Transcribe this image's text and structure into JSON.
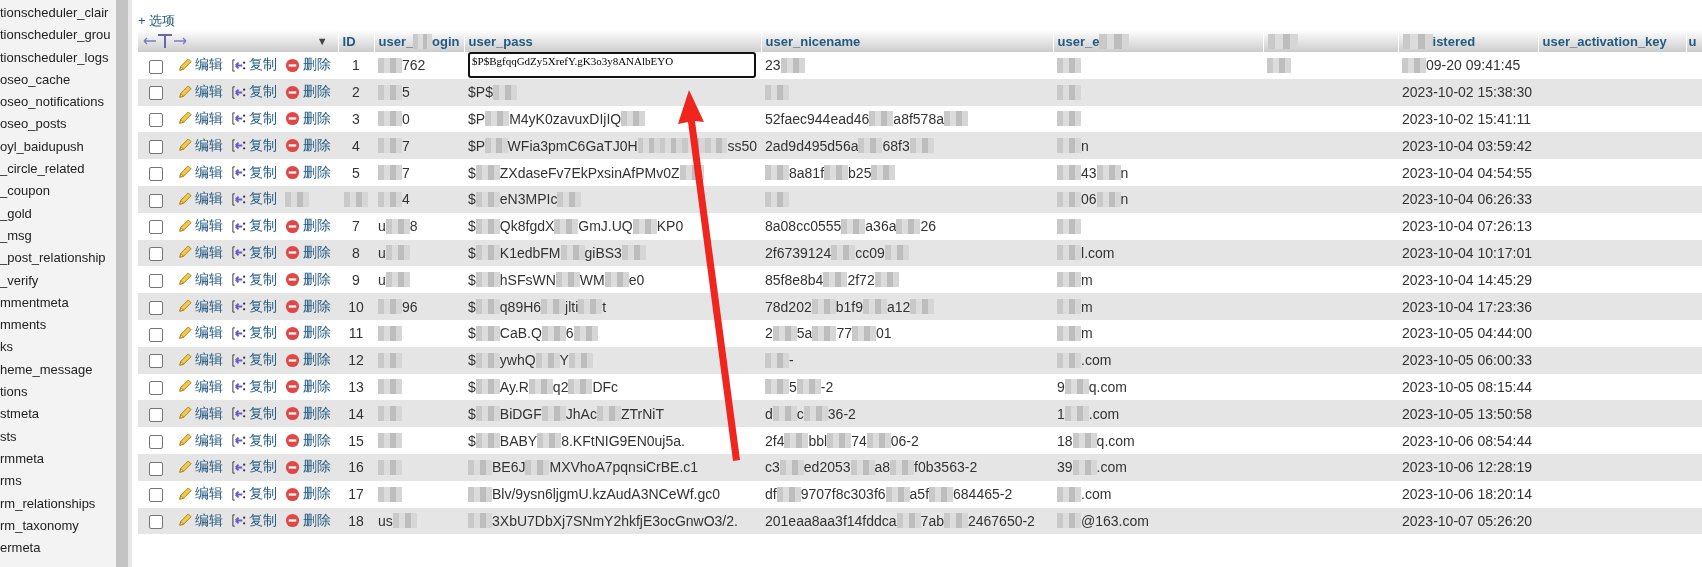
{
  "sidebar": {
    "items": [
      "tionscheduler_clair",
      "tionscheduler_grou",
      "tionscheduler_logs",
      "oseo_cache",
      "oseo_notifications",
      "oseo_posts",
      "oyl_baidupush",
      "_circle_related",
      "_coupon",
      "_gold",
      "_msg",
      "_post_relationship",
      "_verify",
      "mmentmeta",
      "mments",
      "ks",
      "heme_message",
      "tions",
      "stmeta",
      "sts",
      "rmmeta",
      "rms",
      "rm_relationships",
      "rm_taxonomy",
      "ermeta"
    ]
  },
  "options_link": "+ 选项",
  "sort_caret": "▼",
  "columns": [
    [
      {
        "kind": "text",
        "text": "ID"
      }
    ],
    [
      "user_",
      {
        "kind": "blur"
      },
      "ogin"
    ],
    [
      "user_pass"
    ],
    [
      "user_nicename"
    ],
    [
      "user_e",
      {
        "kind": "blur"
      }
    ],
    [
      {
        "kind": "blur"
      }
    ],
    [
      {
        "kind": "blur"
      },
      "istered"
    ],
    [
      "user_activation_key"
    ],
    [
      "u"
    ]
  ],
  "rows": [
    {
      "checked": false,
      "actions": [
        {
          "kind": "edit",
          "label": "编辑"
        },
        {
          "kind": "copy",
          "label": "复制"
        },
        {
          "kind": "delete",
          "label": "删除"
        }
      ],
      "cells": [
        [
          "1"
        ],
        [
          {
            "kind": "blur"
          },
          "762"
        ],
        [
          {
            "kind": "field",
            "value": "$P$BgfqqGdZy5XrefY.gK3o3y8ANAlbEYO"
          }
        ],
        [
          "23",
          {
            "kind": "blur"
          }
        ],
        [
          {
            "kind": "blur"
          }
        ],
        [
          {
            "kind": "blur"
          }
        ],
        [
          {
            "kind": "blur"
          },
          "09-20 09:41:45"
        ]
      ]
    },
    {
      "checked": false,
      "actions": [
        {
          "kind": "edit",
          "label": "编辑"
        },
        {
          "kind": "copy",
          "label": "复制"
        },
        {
          "kind": "delete",
          "label": "删除"
        }
      ],
      "cells": [
        [
          "2"
        ],
        [
          {
            "kind": "blur"
          },
          "5"
        ],
        [
          "$P$",
          {
            "kind": "blur"
          }
        ],
        [
          {
            "kind": "blur"
          }
        ],
        [
          {
            "kind": "blur"
          }
        ],
        [],
        [
          "2023-10-02 15:38:30"
        ]
      ]
    },
    {
      "checked": false,
      "actions": [
        {
          "kind": "edit",
          "label": "编辑"
        },
        {
          "kind": "copy",
          "label": "复制"
        },
        {
          "kind": "delete",
          "label": "删除"
        }
      ],
      "cells": [
        [
          "3"
        ],
        [
          {
            "kind": "blur"
          },
          "0"
        ],
        [
          "$P",
          {
            "kind": "blur"
          },
          "M4yK0zavuxDIjIQ",
          {
            "kind": "blur"
          }
        ],
        [
          "52faec944ead46",
          {
            "kind": "blur"
          },
          "a8f578a",
          {
            "kind": "blur"
          }
        ],
        [
          {
            "kind": "blur"
          }
        ],
        [],
        [
          "2023-10-02 15:41:11"
        ]
      ]
    },
    {
      "checked": false,
      "actions": [
        {
          "kind": "edit",
          "label": "编辑"
        },
        {
          "kind": "copy",
          "label": "复制"
        },
        {
          "kind": "delete",
          "label": "删除"
        }
      ],
      "cells": [
        [
          "4"
        ],
        [
          {
            "kind": "blur"
          },
          "7"
        ],
        [
          "$P",
          {
            "kind": "blur"
          },
          "WFia3pmC6GaTJ0H",
          {
            "kind": "blur"
          },
          {
            "kind": "blur"
          },
          {
            "kind": "blur"
          },
          {
            "kind": "blur"
          },
          "ss50"
        ],
        [
          "2ad9d495d56a",
          {
            "kind": "blur"
          },
          "68f3",
          {
            "kind": "blur"
          }
        ],
        [
          {
            "kind": "blur"
          },
          "n"
        ],
        [],
        [
          "2023-10-04 03:59:42"
        ]
      ]
    },
    {
      "checked": false,
      "actions": [
        {
          "kind": "edit",
          "label": "编辑"
        },
        {
          "kind": "copy",
          "label": "复制"
        },
        {
          "kind": "delete",
          "label": "删除"
        }
      ],
      "cells": [
        [
          "5"
        ],
        [
          {
            "kind": "blur"
          },
          "7"
        ],
        [
          "$",
          {
            "kind": "blur"
          },
          "ZXdaseFv7EkPxsinAfPMv0Z",
          {
            "kind": "blur"
          }
        ],
        [
          {
            "kind": "blur"
          },
          "8a81f",
          {
            "kind": "blur"
          },
          "b25",
          {
            "kind": "blur"
          }
        ],
        [
          {
            "kind": "blur"
          },
          "43",
          {
            "kind": "blur"
          },
          "n"
        ],
        [],
        [
          "2023-10-04 04:54:55"
        ]
      ]
    },
    {
      "checked": false,
      "actions": [
        {
          "kind": "edit",
          "label": "编辑"
        },
        {
          "kind": "copy",
          "label": "复制"
        },
        {
          "kind": "blur"
        }
      ],
      "cells": [
        [
          {
            "kind": "blur"
          }
        ],
        [
          {
            "kind": "blur"
          },
          "4"
        ],
        [
          "$",
          {
            "kind": "blur"
          },
          "eN3MPIc",
          {
            "kind": "blur"
          }
        ],
        [
          {
            "kind": "blur"
          }
        ],
        [
          {
            "kind": "blur"
          },
          "06",
          {
            "kind": "blur"
          },
          "n"
        ],
        [],
        [
          "2023-10-04 06:26:33"
        ]
      ]
    },
    {
      "checked": false,
      "actions": [
        {
          "kind": "edit",
          "label": "编辑"
        },
        {
          "kind": "copy",
          "label": "复制"
        },
        {
          "kind": "delete",
          "label": "删除"
        }
      ],
      "cells": [
        [
          "7"
        ],
        [
          "u",
          {
            "kind": "blur"
          },
          "8"
        ],
        [
          "$",
          {
            "kind": "blur"
          },
          "Qk8fgdX",
          {
            "kind": "blur"
          },
          "GmJ.UQ",
          {
            "kind": "blur"
          },
          "KP0"
        ],
        [
          "8a08cc0555",
          {
            "kind": "blur"
          },
          "a36a",
          {
            "kind": "blur"
          },
          "26"
        ],
        [
          {
            "kind": "blur"
          }
        ],
        [],
        [
          "2023-10-04 07:26:13"
        ]
      ]
    },
    {
      "checked": false,
      "actions": [
        {
          "kind": "edit",
          "label": "编辑"
        },
        {
          "kind": "copy",
          "label": "复制"
        },
        {
          "kind": "delete",
          "label": "删除"
        }
      ],
      "cells": [
        [
          "8"
        ],
        [
          "u",
          {
            "kind": "blur"
          }
        ],
        [
          "$",
          {
            "kind": "blur"
          },
          "K1edbFM",
          {
            "kind": "blur"
          },
          "giBS3",
          {
            "kind": "blur"
          }
        ],
        [
          "2f6739124",
          {
            "kind": "blur"
          },
          "cc09",
          {
            "kind": "blur"
          }
        ],
        [
          {
            "kind": "blur"
          },
          "l.com"
        ],
        [],
        [
          "2023-10-04 10:17:01"
        ]
      ]
    },
    {
      "checked": false,
      "actions": [
        {
          "kind": "edit",
          "label": "编辑"
        },
        {
          "kind": "copy",
          "label": "复制"
        },
        {
          "kind": "delete",
          "label": "删除"
        }
      ],
      "cells": [
        [
          "9"
        ],
        [
          "u",
          {
            "kind": "blur"
          }
        ],
        [
          "$",
          {
            "kind": "blur"
          },
          "hSFsWN",
          {
            "kind": "blur"
          },
          "WM",
          {
            "kind": "blur"
          },
          "e0"
        ],
        [
          "85f8e8b4",
          {
            "kind": "blur"
          },
          "2f72",
          {
            "kind": "blur"
          }
        ],
        [
          {
            "kind": "blur"
          },
          "m"
        ],
        [],
        [
          "2023-10-04 14:45:29"
        ]
      ]
    },
    {
      "checked": false,
      "actions": [
        {
          "kind": "edit",
          "label": "编辑"
        },
        {
          "kind": "copy",
          "label": "复制"
        },
        {
          "kind": "delete",
          "label": "删除"
        }
      ],
      "cells": [
        [
          "10"
        ],
        [
          {
            "kind": "blur"
          },
          "96"
        ],
        [
          "$",
          {
            "kind": "blur"
          },
          "q89H6",
          {
            "kind": "blur"
          },
          "jlti",
          {
            "kind": "blur"
          },
          "t"
        ],
        [
          "78d202",
          {
            "kind": "blur"
          },
          "b1f9",
          {
            "kind": "blur"
          },
          "a12",
          {
            "kind": "blur"
          }
        ],
        [
          {
            "kind": "blur"
          },
          "m"
        ],
        [],
        [
          "2023-10-04 17:23:36"
        ]
      ]
    },
    {
      "checked": false,
      "actions": [
        {
          "kind": "edit",
          "label": "编辑"
        },
        {
          "kind": "copy",
          "label": "复制"
        },
        {
          "kind": "delete",
          "label": "删除"
        }
      ],
      "cells": [
        [
          "11"
        ],
        [
          {
            "kind": "blur"
          }
        ],
        [
          "$",
          {
            "kind": "blur"
          },
          "CaB.Q",
          {
            "kind": "blur"
          },
          "6",
          {
            "kind": "blur"
          }
        ],
        [
          "2",
          {
            "kind": "blur"
          },
          "5a",
          {
            "kind": "blur"
          },
          "77",
          {
            "kind": "blur"
          },
          "01"
        ],
        [
          {
            "kind": "blur"
          },
          "m"
        ],
        [],
        [
          "2023-10-05 04:44:00"
        ]
      ]
    },
    {
      "checked": false,
      "actions": [
        {
          "kind": "edit",
          "label": "编辑"
        },
        {
          "kind": "copy",
          "label": "复制"
        },
        {
          "kind": "delete",
          "label": "删除"
        }
      ],
      "cells": [
        [
          "12"
        ],
        [
          {
            "kind": "blur"
          }
        ],
        [
          "$",
          {
            "kind": "blur"
          },
          "ywhQ",
          {
            "kind": "blur"
          },
          "Y",
          {
            "kind": "blur"
          }
        ],
        [
          {
            "kind": "blur"
          },
          "-"
        ],
        [
          {
            "kind": "blur"
          },
          ".com"
        ],
        [],
        [
          "2023-10-05 06:00:33"
        ]
      ]
    },
    {
      "checked": false,
      "actions": [
        {
          "kind": "edit",
          "label": "编辑"
        },
        {
          "kind": "copy",
          "label": "复制"
        },
        {
          "kind": "delete",
          "label": "删除"
        }
      ],
      "cells": [
        [
          "13"
        ],
        [
          {
            "kind": "blur"
          }
        ],
        [
          "$",
          {
            "kind": "blur"
          },
          "Ay.R",
          {
            "kind": "blur"
          },
          "q2",
          {
            "kind": "blur"
          },
          "DFc"
        ],
        [
          {
            "kind": "blur"
          },
          "5",
          {
            "kind": "blur"
          },
          "-2"
        ],
        [
          "9",
          {
            "kind": "blur"
          },
          "q.com"
        ],
        [],
        [
          "2023-10-05 08:15:44"
        ]
      ]
    },
    {
      "checked": false,
      "actions": [
        {
          "kind": "edit",
          "label": "编辑"
        },
        {
          "kind": "copy",
          "label": "复制"
        },
        {
          "kind": "delete",
          "label": "删除"
        }
      ],
      "cells": [
        [
          "14"
        ],
        [
          {
            "kind": "blur"
          }
        ],
        [
          "$",
          {
            "kind": "blur"
          },
          "BiDGF",
          {
            "kind": "blur"
          },
          "JhAc",
          {
            "kind": "blur"
          },
          "ZTrNiT"
        ],
        [
          "d",
          {
            "kind": "blur"
          },
          "c",
          {
            "kind": "blur"
          },
          "36-2"
        ],
        [
          "1",
          {
            "kind": "blur"
          },
          ".com"
        ],
        [],
        [
          "2023-10-05 13:50:58"
        ]
      ]
    },
    {
      "checked": false,
      "actions": [
        {
          "kind": "edit",
          "label": "编辑"
        },
        {
          "kind": "copy",
          "label": "复制"
        },
        {
          "kind": "delete",
          "label": "删除"
        }
      ],
      "cells": [
        [
          "15"
        ],
        [
          {
            "kind": "blur"
          }
        ],
        [
          "$",
          {
            "kind": "blur"
          },
          "BABY",
          {
            "kind": "blur"
          },
          "8.KFtNIG9EN0uj5a."
        ],
        [
          "2f4",
          {
            "kind": "blur"
          },
          "bbl",
          {
            "kind": "blur"
          },
          "74",
          {
            "kind": "blur"
          },
          "06-2"
        ],
        [
          "18",
          {
            "kind": "blur"
          },
          "q.com"
        ],
        [],
        [
          "2023-10-06 08:54:44"
        ]
      ]
    },
    {
      "checked": false,
      "actions": [
        {
          "kind": "edit",
          "label": "编辑"
        },
        {
          "kind": "copy",
          "label": "复制"
        },
        {
          "kind": "delete",
          "label": "删除"
        }
      ],
      "cells": [
        [
          "16"
        ],
        [
          {
            "kind": "blur"
          }
        ],
        [
          {
            "kind": "blur"
          },
          "BE6J",
          {
            "kind": "blur"
          },
          "MXVhoA7pqnsiCrBE.c1"
        ],
        [
          "c3",
          {
            "kind": "blur"
          },
          "ed2053",
          {
            "kind": "blur"
          },
          "a8",
          {
            "kind": "blur"
          },
          "f0b3563-2"
        ],
        [
          "39",
          {
            "kind": "blur"
          },
          ".com"
        ],
        [],
        [
          "2023-10-06 12:28:19"
        ]
      ]
    },
    {
      "checked": false,
      "actions": [
        {
          "kind": "edit",
          "label": "编辑"
        },
        {
          "kind": "copy",
          "label": "复制"
        },
        {
          "kind": "delete",
          "label": "删除"
        }
      ],
      "cells": [
        [
          "17"
        ],
        [
          {
            "kind": "blur"
          }
        ],
        [
          {
            "kind": "blur"
          },
          "Blv/9ysn6ljgmU.kzAudA3NCeWf.gc0"
        ],
        [
          "df",
          {
            "kind": "blur"
          },
          "9707f8c303f6",
          {
            "kind": "blur"
          },
          "a5f",
          {
            "kind": "blur"
          },
          "684465-2"
        ],
        [
          {
            "kind": "blur"
          },
          ".com"
        ],
        [],
        [
          "2023-10-06 18:20:14"
        ]
      ]
    },
    {
      "checked": false,
      "actions": [
        {
          "kind": "edit",
          "label": "编辑"
        },
        {
          "kind": "copy",
          "label": "复制"
        },
        {
          "kind": "delete",
          "label": "删除"
        }
      ],
      "cells": [
        [
          "18"
        ],
        [
          "us",
          {
            "kind": "blur"
          }
        ],
        [
          {
            "kind": "blur"
          },
          "3XbU7DbXj7SNmY2hkfjE3ocGnwO3/2."
        ],
        [
          "201eaa8aa3f14fddca",
          {
            "kind": "blur"
          },
          "7ab",
          {
            "kind": "blur"
          },
          "2467650-2"
        ],
        [
          {
            "kind": "blur"
          },
          "@163.com"
        ],
        [],
        [
          "2023-10-07 05:26:20"
        ]
      ]
    }
  ]
}
